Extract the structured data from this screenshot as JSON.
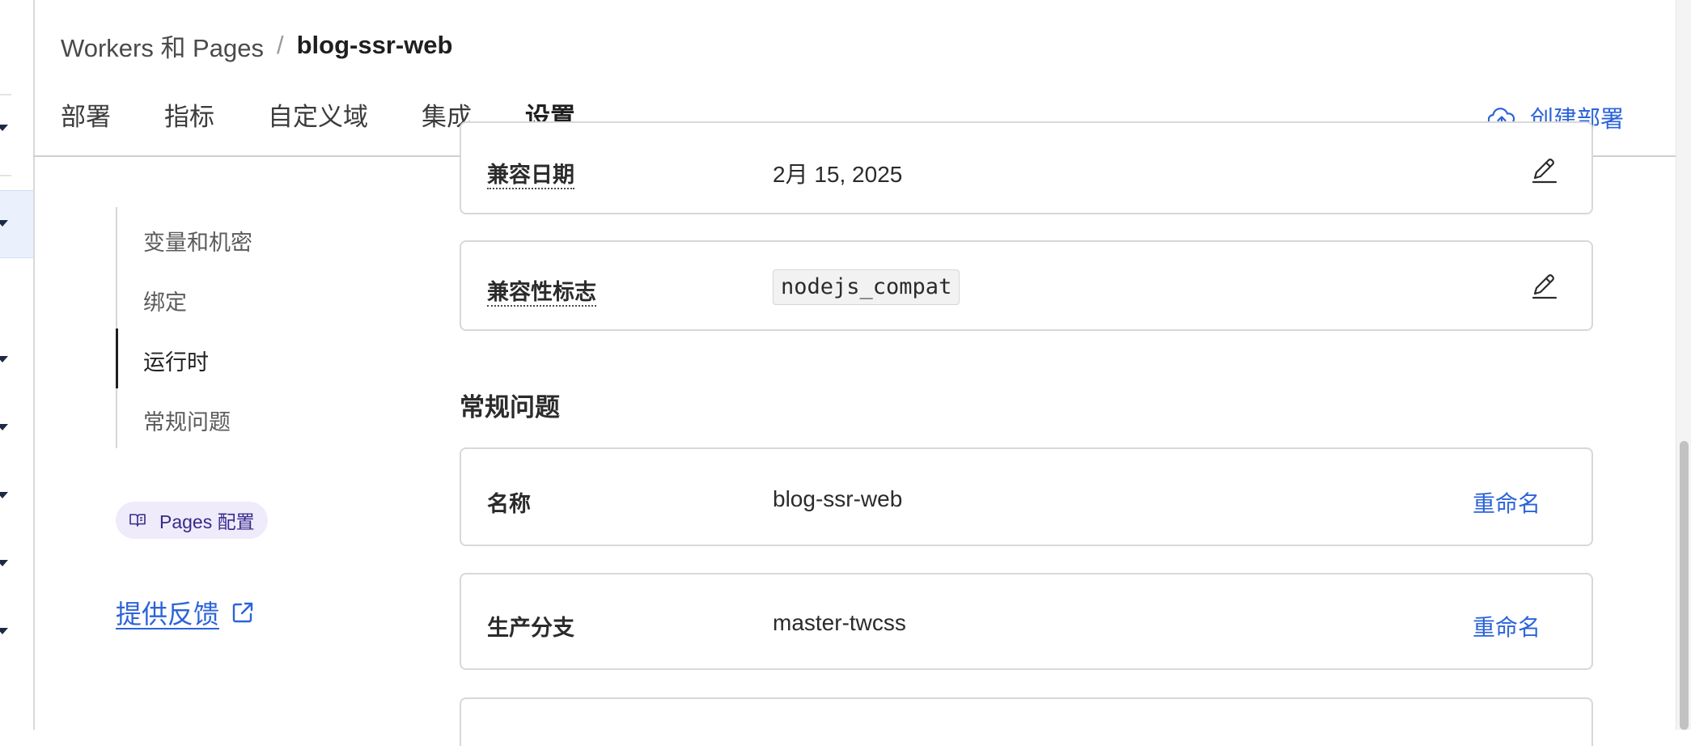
{
  "breadcrumb": {
    "parent": "Workers 和 Pages",
    "separator": "/",
    "current": "blog-ssr-web"
  },
  "tabs": [
    {
      "label": "部署"
    },
    {
      "label": "指标"
    },
    {
      "label": "自定义域"
    },
    {
      "label": "集成"
    },
    {
      "label": "设置",
      "active": true
    }
  ],
  "create_deploy": {
    "label": "创建部署",
    "icon": "cloud-upload-icon"
  },
  "section_nav": {
    "items": [
      {
        "label": "变量和机密"
      },
      {
        "label": "绑定"
      },
      {
        "label": "运行时",
        "active": true
      },
      {
        "label": "常规问题"
      }
    ]
  },
  "pages_config": {
    "label": "Pages 配置",
    "icon": "book-icon"
  },
  "feedback": {
    "label": "提供反馈",
    "icon": "external-link-icon"
  },
  "runtime": {
    "compat_date": {
      "label": "兼容日期",
      "value": "2月 15, 2025"
    },
    "compat_flags": {
      "label": "兼容性标志",
      "value": "nodejs_compat"
    }
  },
  "general": {
    "heading": "常规问题",
    "name": {
      "label": "名称",
      "value": "blog-ssr-web",
      "action": "重命名"
    },
    "production_branch": {
      "label": "生产分支",
      "value": "master-twcss",
      "action": "重命名"
    }
  },
  "colors": {
    "accent": "#2b63d9",
    "tab_underline": "#2f5ad3",
    "pill_bg": "#efebfb"
  }
}
